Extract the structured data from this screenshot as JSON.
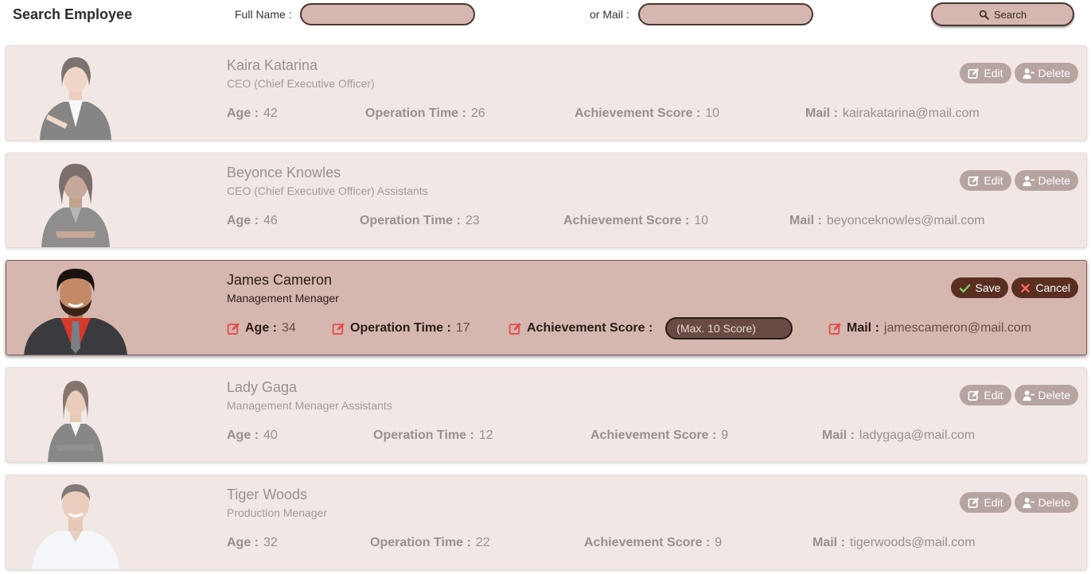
{
  "header": {
    "title": "Search Employee",
    "full_name_label": "Full Name :",
    "mail_label": "or Mail :",
    "full_name_value": "",
    "mail_value": "",
    "search_label": "Search"
  },
  "buttons": {
    "edit": "Edit",
    "delete": "Delete",
    "save": "Save",
    "cancel": "Cancel"
  },
  "field_labels": {
    "age": "Age :",
    "operation_time": "Operation Time :",
    "achievement_score": "Achievement Score :",
    "mail": "Mail :"
  },
  "score_placeholder": "(Max. 10 Score)",
  "employees": [
    {
      "name": "Kaira Katarina",
      "role": "CEO (Chief Executive Officer)",
      "age": "42",
      "operation_time": "26",
      "achievement_score": "10",
      "mail": "kairakatarina@mail.com",
      "editing": false
    },
    {
      "name": "Beyonce Knowles",
      "role": "CEO (Chief Executive Officer) Assistants",
      "age": "46",
      "operation_time": "23",
      "achievement_score": "10",
      "mail": "beyonceknowles@mail.com",
      "editing": false
    },
    {
      "name": "James Cameron",
      "role": "Management Menager",
      "age": "34",
      "operation_time": "17",
      "achievement_score": "",
      "mail": "jamescameron@mail.com",
      "editing": true
    },
    {
      "name": "Lady Gaga",
      "role": "Management Menager Assistants",
      "age": "40",
      "operation_time": "12",
      "achievement_score": "9",
      "mail": "ladygaga@mail.com",
      "editing": false
    },
    {
      "name": "Tiger Woods",
      "role": "Production Menager",
      "age": "32",
      "operation_time": "22",
      "achievement_score": "9",
      "mail": "tigerwoods@mail.com",
      "editing": false
    }
  ],
  "colors": {
    "card_bg": "#e9dbd8",
    "active_card_bg": "#d5b7b0",
    "accent_edit_icon": "#e0514d",
    "dark_button": "#5a2f22",
    "input_fill": "#d6b6b0"
  }
}
